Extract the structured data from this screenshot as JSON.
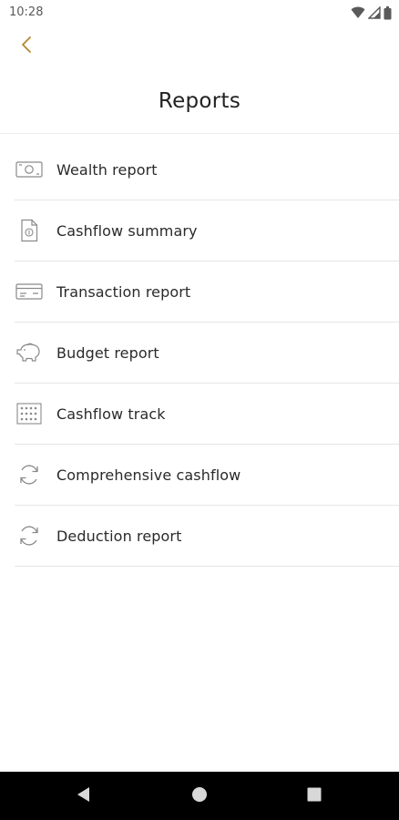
{
  "status_bar": {
    "time": "10:28"
  },
  "header": {
    "title": "Reports",
    "back_icon": "chevron-left-icon",
    "accent_color": "#b8862e"
  },
  "reports": [
    {
      "label": "Wealth report",
      "icon": "banknote-icon"
    },
    {
      "label": "Cashflow summary",
      "icon": "document-money-icon"
    },
    {
      "label": "Transaction report",
      "icon": "credit-card-icon"
    },
    {
      "label": "Budget report",
      "icon": "piggy-bank-icon"
    },
    {
      "label": "Cashflow track",
      "icon": "grid-dots-icon"
    },
    {
      "label": "Comprehensive cashflow",
      "icon": "sync-icon"
    },
    {
      "label": "Deduction report",
      "icon": "sync-icon"
    }
  ],
  "nav_bar": {
    "back": "nav-back-icon",
    "home": "nav-home-icon",
    "recents": "nav-recents-icon"
  }
}
